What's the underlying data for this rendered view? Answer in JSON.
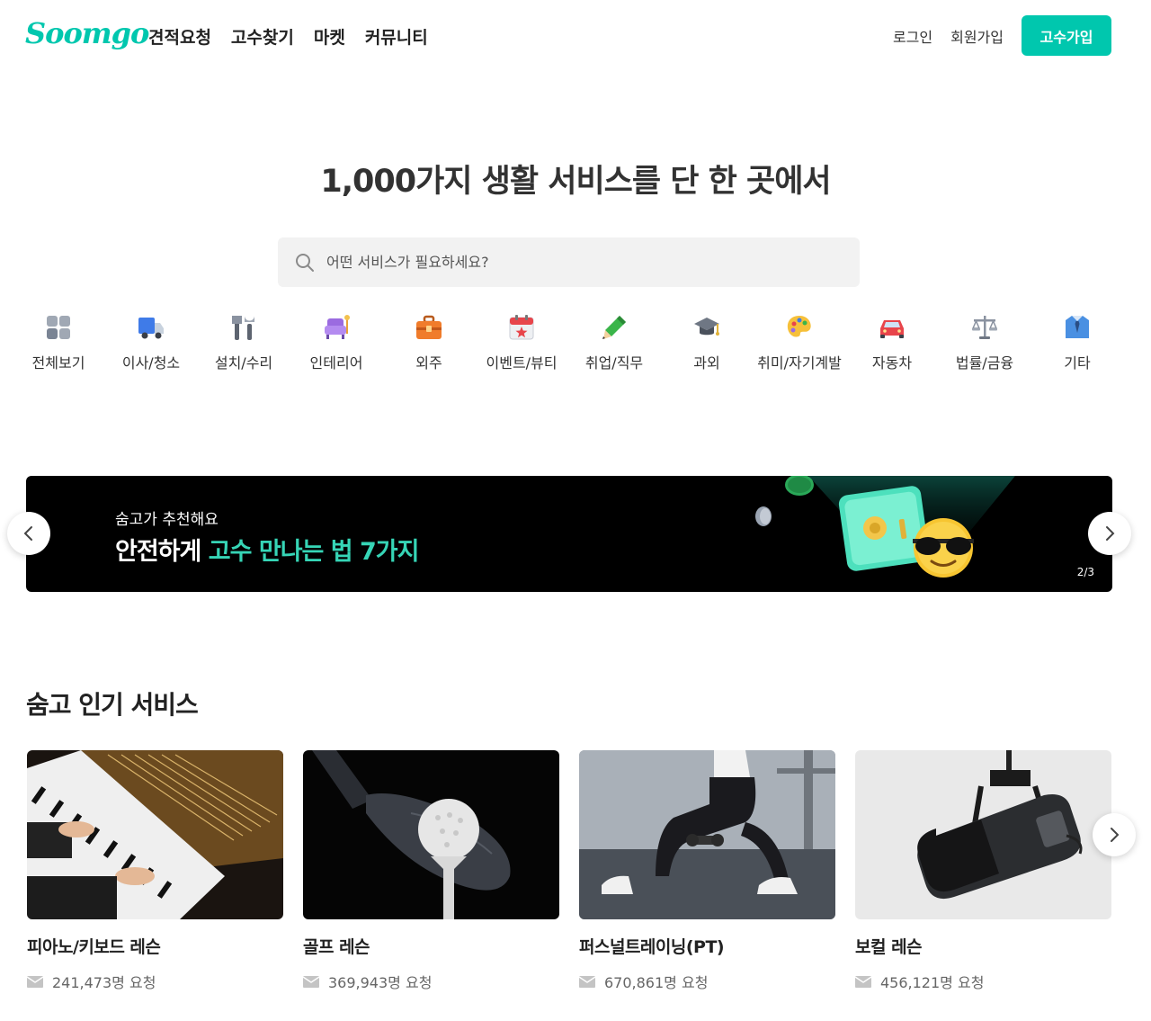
{
  "brand": {
    "logo_text": "Soomgo",
    "accent": "#00c7ae"
  },
  "nav": {
    "items": [
      "견적요청",
      "고수찾기",
      "마켓",
      "커뮤니티"
    ]
  },
  "auth": {
    "login": "로그인",
    "signup": "회원가입",
    "pro_join": "고수가입"
  },
  "hero": {
    "title": "1,000가지 생활 서비스를 단 한 곳에서"
  },
  "search": {
    "placeholder": "어떤 서비스가 필요하세요?"
  },
  "categories": [
    {
      "label": "전체보기",
      "icon": "grid-icon"
    },
    {
      "label": "이사/청소",
      "icon": "truck-icon"
    },
    {
      "label": "설치/수리",
      "icon": "tools-icon"
    },
    {
      "label": "인테리어",
      "icon": "sofa-icon"
    },
    {
      "label": "외주",
      "icon": "briefcase-icon"
    },
    {
      "label": "이벤트/뷰티",
      "icon": "calendar-icon"
    },
    {
      "label": "취업/직무",
      "icon": "pencil-icon"
    },
    {
      "label": "과외",
      "icon": "graduation-cap-icon"
    },
    {
      "label": "취미/자기계발",
      "icon": "palette-icon"
    },
    {
      "label": "자동차",
      "icon": "car-icon"
    },
    {
      "label": "법률/금융",
      "icon": "scale-icon"
    },
    {
      "label": "기타",
      "icon": "shirt-icon"
    }
  ],
  "banner": {
    "subtitle": "숨고가 추천해요",
    "title_white": "안전하게",
    "title_highlight": "고수 만나는 법 7가지",
    "counter": "2/3",
    "highlight_color": "#36d5b6"
  },
  "popular": {
    "title": "숨고 인기 서비스",
    "cards": [
      {
        "title": "피아노/키보드 레슨",
        "requests": "241,473명 요청",
        "image": "piano-image"
      },
      {
        "title": "골프 레슨",
        "requests": "369,943명 요청",
        "image": "golf-image"
      },
      {
        "title": "퍼스널트레이닝(PT)",
        "requests": "670,861명 요청",
        "image": "fitness-image"
      },
      {
        "title": "보컬 레슨",
        "requests": "456,121명 요청",
        "image": "microphone-image"
      }
    ]
  }
}
